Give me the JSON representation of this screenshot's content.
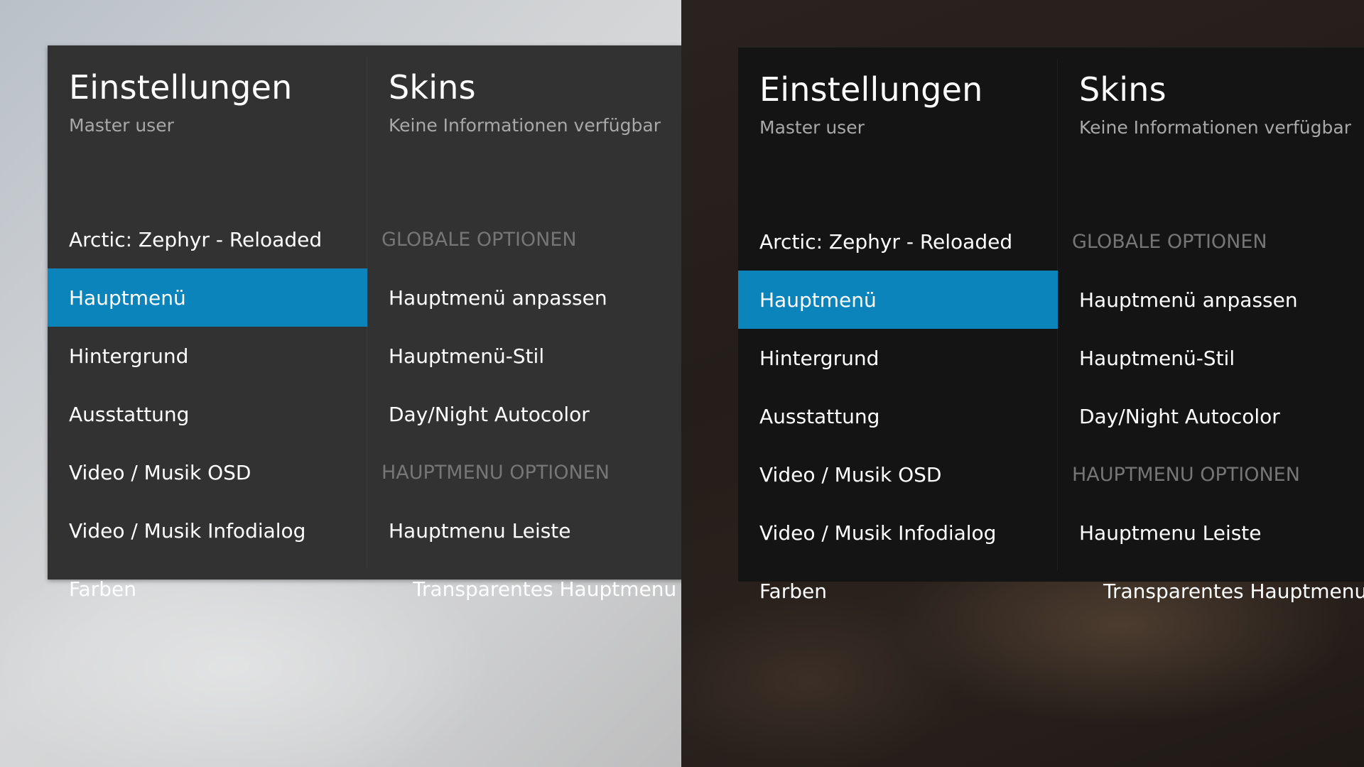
{
  "variants": {
    "light": {
      "col1": {
        "title": "Einstellungen",
        "subtitle": "Master user",
        "items": [
          {
            "label": "Arctic: Zephyr - Reloaded"
          },
          {
            "label": "Hauptmenü",
            "selected": true
          },
          {
            "label": "Hintergrund"
          },
          {
            "label": "Ausstattung"
          },
          {
            "label": "Video / Musik OSD"
          },
          {
            "label": "Video / Musik Infodialog"
          },
          {
            "label": "Farben"
          }
        ]
      },
      "col2": {
        "title": "Skins",
        "subtitle": "Keine Informationen verfügbar",
        "items": [
          {
            "label": "GLOBALE OPTIONEN",
            "type": "header"
          },
          {
            "label": "Hauptmenü anpassen"
          },
          {
            "label": "Hauptmenü-Stil"
          },
          {
            "label": "Day/Night Autocolor"
          },
          {
            "label": "HAUPTMENU OPTIONEN",
            "type": "header"
          },
          {
            "label": "Hauptmenu Leiste"
          },
          {
            "label": "Transparentes Hauptmenu",
            "indent": true
          }
        ]
      }
    },
    "dark": {
      "col1": {
        "title": "Einstellungen",
        "subtitle": "Master user",
        "items": [
          {
            "label": "Arctic: Zephyr - Reloaded"
          },
          {
            "label": "Hauptmenü",
            "selected": true
          },
          {
            "label": "Hintergrund"
          },
          {
            "label": "Ausstattung"
          },
          {
            "label": "Video / Musik OSD"
          },
          {
            "label": "Video / Musik Infodialog"
          },
          {
            "label": "Farben"
          }
        ]
      },
      "col2": {
        "title": "Skins",
        "subtitle": "Keine Informationen verfügbar",
        "items": [
          {
            "label": "GLOBALE OPTIONEN",
            "type": "header"
          },
          {
            "label": "Hauptmenü anpassen"
          },
          {
            "label": "Hauptmenü-Stil"
          },
          {
            "label": "Day/Night Autocolor"
          },
          {
            "label": "HAUPTMENU OPTIONEN",
            "type": "header"
          },
          {
            "label": "Hauptmenu Leiste"
          },
          {
            "label": "Transparentes Hauptmenu",
            "indent": true
          }
        ]
      }
    }
  },
  "colors": {
    "accent": "#0a84bb",
    "panel_light": "#323232",
    "panel_dark": "#141414",
    "header_text": "#767676"
  }
}
